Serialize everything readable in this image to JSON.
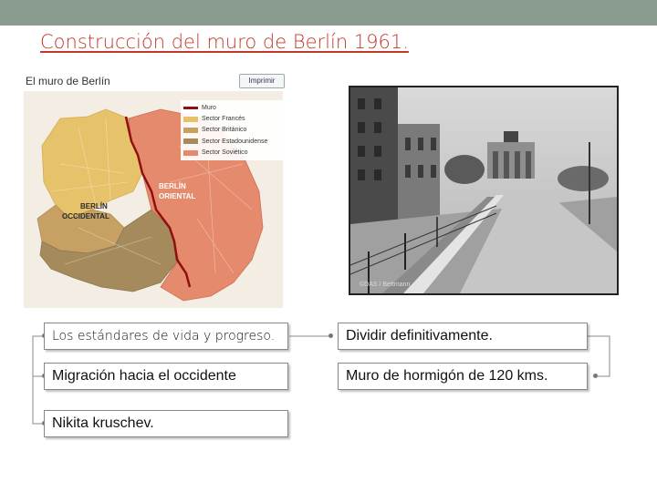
{
  "slide": {
    "title": "Construcción del muro de Berlín 1961."
  },
  "map": {
    "title": "El muro de Berlín",
    "print_label": "Imprimir",
    "legend": [
      {
        "label": "Muro",
        "color": "#8e1010"
      },
      {
        "label": "Sector Francés",
        "color": "#e6c36a"
      },
      {
        "label": "Sector Británico",
        "color": "#c7a064"
      },
      {
        "label": "Sector Estadounidense",
        "color": "#a58a5c"
      },
      {
        "label": "Sector Soviético",
        "color": "#e58a6c"
      }
    ],
    "west_label_1": "BERLÍN",
    "west_label_2": "OCCIDENTAL",
    "east_label_1": "BERLÍN",
    "east_label_2": "ORIENTAL"
  },
  "photo": {
    "credit": "©DAS / Bettmann"
  },
  "matching": {
    "left": [
      "Los estándares de vida y progreso.",
      "Migración hacia el occidente",
      "Nikita kruschev."
    ],
    "right": [
      "Dividir definitivamente.",
      "Muro de hormigón de 120 kms."
    ]
  }
}
